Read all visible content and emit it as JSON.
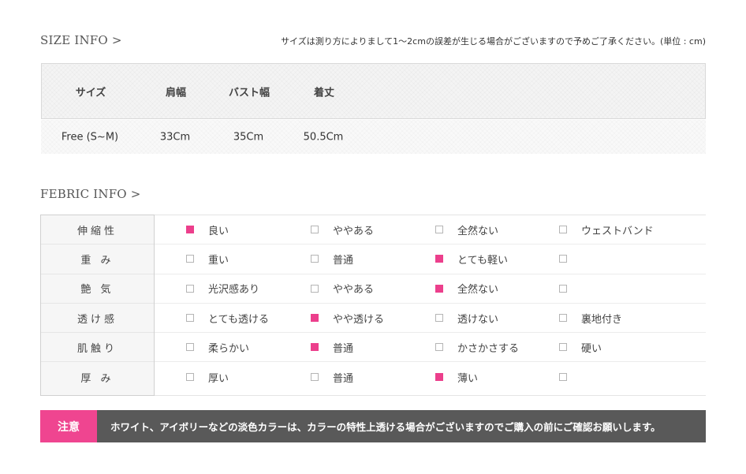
{
  "size_info": {
    "title": "SIZE INFO >",
    "note": "サイズは測り方によりまして1〜2cmの誤差が生じる場合がございますので予めご了承ください。(単位 : cm)",
    "headers": [
      "サイズ",
      "肩幅",
      "バスト幅",
      "着丈"
    ],
    "rows": [
      [
        "Free (S~M)",
        "33Cm",
        "35Cm",
        "50.5Cm"
      ]
    ]
  },
  "fabric_info": {
    "title": "FEBRIC INFO >",
    "rows": [
      {
        "label": "伸縮性",
        "options": [
          {
            "text": "良い",
            "checked": true
          },
          {
            "text": "ややある",
            "checked": false
          },
          {
            "text": "全然ない",
            "checked": false
          },
          {
            "text": "ウェストバンド",
            "checked": false
          }
        ]
      },
      {
        "label": "重 み",
        "options": [
          {
            "text": "重い",
            "checked": false
          },
          {
            "text": "普通",
            "checked": false
          },
          {
            "text": "とても軽い",
            "checked": true
          },
          {
            "text": "",
            "checked": false
          }
        ]
      },
      {
        "label": "艶 気",
        "options": [
          {
            "text": "光沢感あり",
            "checked": false
          },
          {
            "text": "ややある",
            "checked": false
          },
          {
            "text": "全然ない",
            "checked": true
          },
          {
            "text": "",
            "checked": false
          }
        ]
      },
      {
        "label": "透け感",
        "options": [
          {
            "text": "とても透ける",
            "checked": false
          },
          {
            "text": "やや透ける",
            "checked": true
          },
          {
            "text": "透けない",
            "checked": false
          },
          {
            "text": "裏地付き",
            "checked": false
          }
        ]
      },
      {
        "label": "肌触り",
        "options": [
          {
            "text": "柔らかい",
            "checked": false
          },
          {
            "text": "普通",
            "checked": true
          },
          {
            "text": "かさかさする",
            "checked": false
          },
          {
            "text": "硬い",
            "checked": false
          }
        ]
      },
      {
        "label": "厚 み",
        "options": [
          {
            "text": "厚い",
            "checked": false
          },
          {
            "text": "普通",
            "checked": false
          },
          {
            "text": "薄い",
            "checked": true
          },
          {
            "text": "",
            "checked": false
          }
        ]
      }
    ]
  },
  "notice": {
    "tag": "注意",
    "text": "ホワイト、アイボリーなどの淡色カラーは、カラーの特性上透ける場合がございますのでご購入の前にご確認お願いします。"
  },
  "colors": {
    "accent": "#ec3f8c",
    "notice_bg": "#595959"
  }
}
